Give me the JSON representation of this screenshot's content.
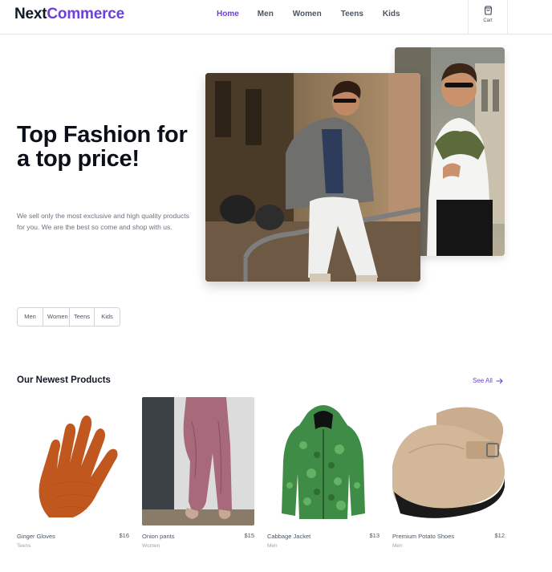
{
  "brand": {
    "part1": "Next",
    "part2": "Commerce"
  },
  "nav": [
    {
      "label": "Home",
      "active": true
    },
    {
      "label": "Men",
      "active": false
    },
    {
      "label": "Women",
      "active": false
    },
    {
      "label": "Teens",
      "active": false
    },
    {
      "label": "Kids",
      "active": false
    }
  ],
  "cart": {
    "label": "Cart",
    "icon": "shopping-bag-icon"
  },
  "hero": {
    "title": "Top Fashion for a top price!",
    "text": "We sell only the most exclusive and high quality products for you. We are the best so come and shop with us."
  },
  "categories": [
    "Men",
    "Women",
    "Teens",
    "Kids"
  ],
  "products_section": {
    "title": "Our Newest Products",
    "see_all": "See All"
  },
  "products": [
    {
      "name": "Ginger Gloves",
      "price": "$16",
      "category": "Teens"
    },
    {
      "name": "Onion pants",
      "price": "$15",
      "category": "Women"
    },
    {
      "name": "Cabbage Jacket",
      "price": "$13",
      "category": "Men"
    },
    {
      "name": "Premium Potato Shoes",
      "price": "$12",
      "category": "Men"
    }
  ],
  "colors": {
    "accent": "#6d3fe0",
    "text": "#111827",
    "muted": "#6b7280"
  }
}
